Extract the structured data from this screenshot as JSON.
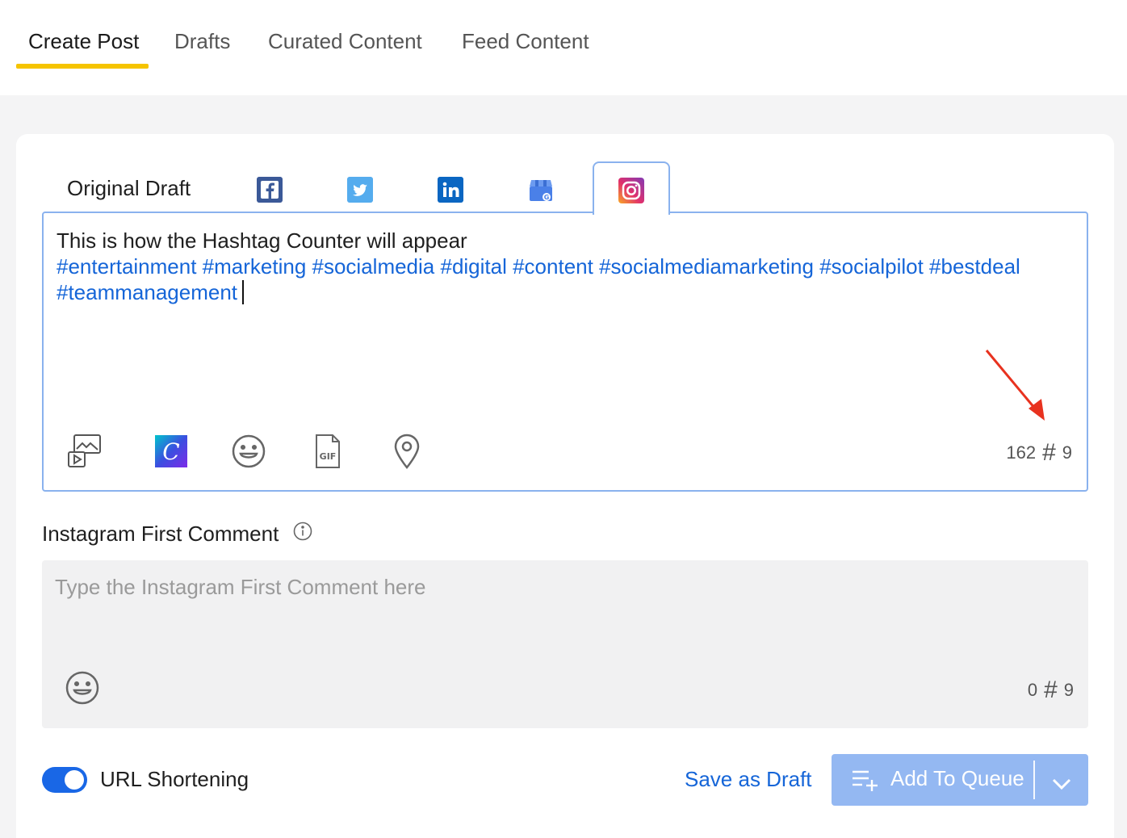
{
  "tabs": [
    {
      "label": "Create Post",
      "active": true
    },
    {
      "label": "Drafts",
      "active": false
    },
    {
      "label": "Curated Content",
      "active": false
    },
    {
      "label": "Feed Content",
      "active": false
    }
  ],
  "network_tabs": {
    "original_draft_label": "Original Draft",
    "icons": [
      "facebook-icon",
      "twitter-icon",
      "linkedin-icon",
      "google-business-icon",
      "instagram-icon"
    ],
    "active": "instagram-icon"
  },
  "editor": {
    "line1": "This is how the Hashtag Counter will appear",
    "hashtags": "#entertainment #marketing #socialmedia #digital #content #socialmediamarketing #socialpilot #bestdeal #teammanagement",
    "char_count": "162",
    "hashtag_count": "9"
  },
  "first_comment": {
    "label": "Instagram First Comment",
    "placeholder": "Type the Instagram First Comment here",
    "char_count": "0",
    "hashtag_count": "9"
  },
  "footer": {
    "url_shortening_label": "URL Shortening",
    "url_shortening_on": true,
    "save_draft_label": "Save as Draft",
    "add_queue_label": "Add To Queue"
  },
  "colors": {
    "accent": "#1967e6",
    "tab_underline": "#f5c400",
    "hashtag": "#1565d8",
    "queue_button": "#94b8f2",
    "annotation_arrow": "#e8321f"
  }
}
